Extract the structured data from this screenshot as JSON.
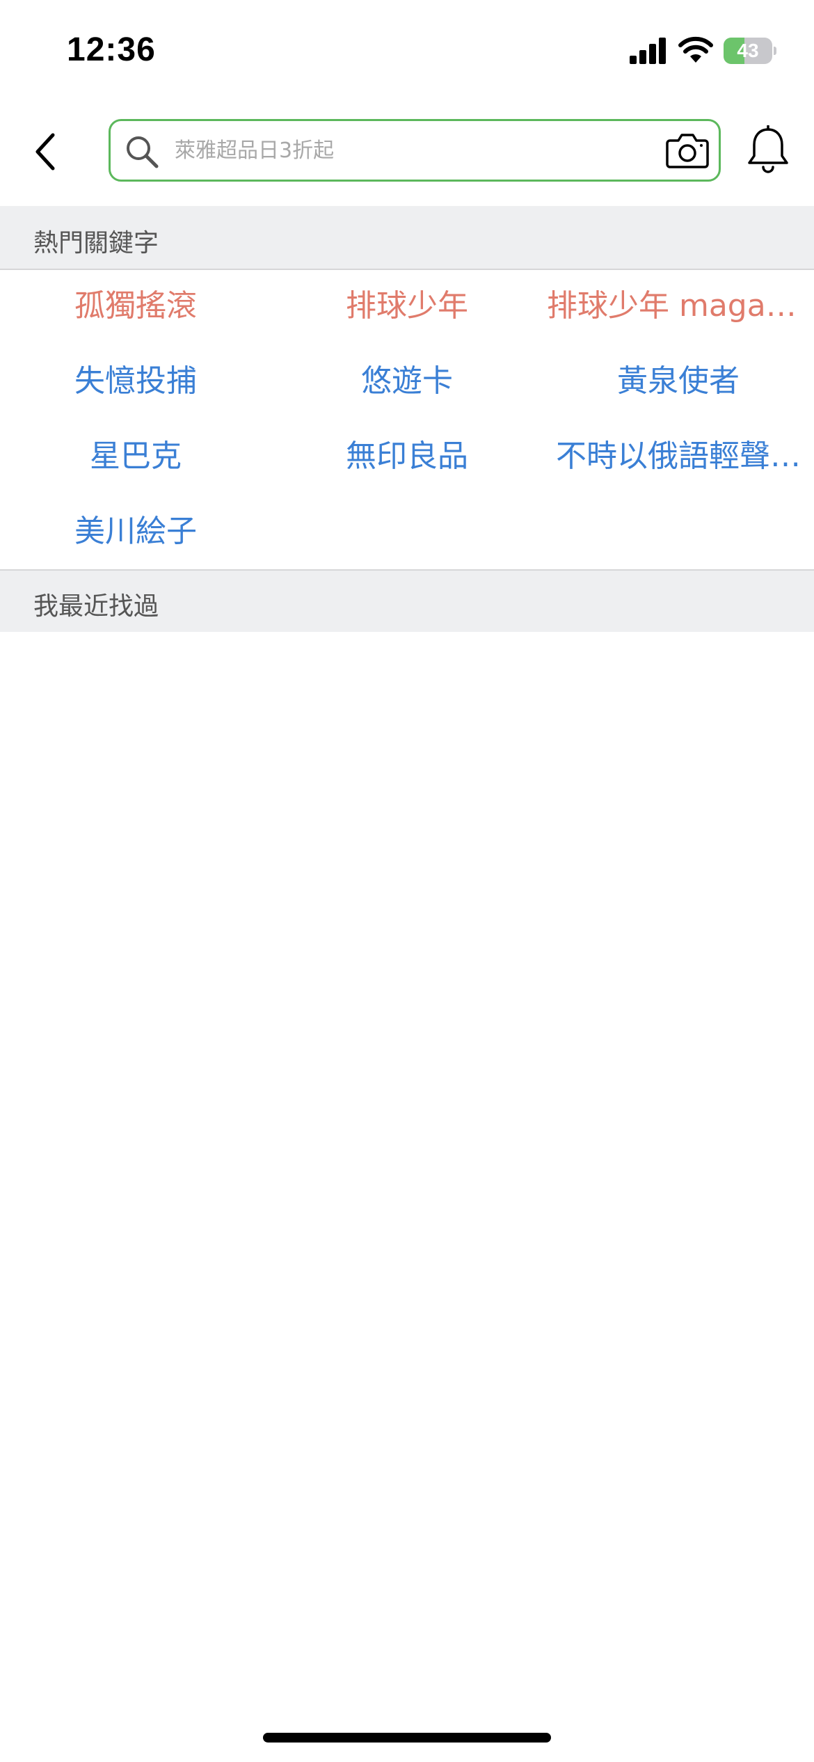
{
  "status_bar": {
    "time": "12:36",
    "battery_level": "43",
    "battery_percent": 43,
    "battery_charging": true
  },
  "search": {
    "placeholder": "萊雅超品日3折起",
    "value": ""
  },
  "hot_keywords": {
    "title": "熱門關鍵字",
    "items": [
      {
        "label": "孤獨搖滾",
        "highlight": true
      },
      {
        "label": "排球少年",
        "highlight": true
      },
      {
        "label": "排球少年 magazine",
        "highlight": true
      },
      {
        "label": "失憶投捕",
        "highlight": false
      },
      {
        "label": "悠遊卡",
        "highlight": false
      },
      {
        "label": "黃泉使者",
        "highlight": false
      },
      {
        "label": "星巴克",
        "highlight": false
      },
      {
        "label": "無印良品",
        "highlight": false
      },
      {
        "label": "不時以俄語輕聲…",
        "highlight": false
      },
      {
        "label": "美川絵子",
        "highlight": false
      }
    ]
  },
  "recent_searches": {
    "title": "我最近找過",
    "items": []
  },
  "colors": {
    "search_border": "#5cb85c",
    "hot_keyword": "#e07b6b",
    "keyword": "#3a7fd5",
    "section_bg": "#eeeff1",
    "battery_fill": "#6cc46b"
  },
  "icons": {
    "back": "chevron-left-icon",
    "search": "search-icon",
    "camera": "camera-icon",
    "notifications": "bell-icon",
    "signal": "cellular-signal-icon",
    "wifi": "wifi-icon",
    "battery": "battery-icon"
  }
}
